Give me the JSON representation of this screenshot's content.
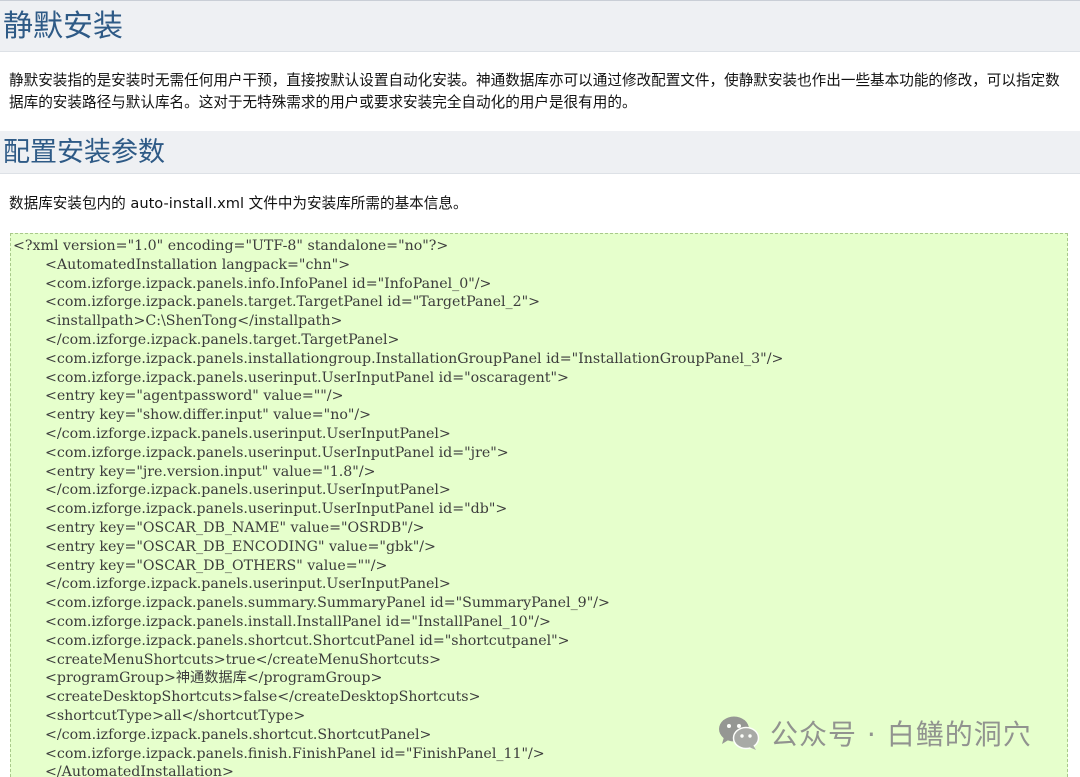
{
  "sections": {
    "silent_install": {
      "title": "静默安装",
      "paragraph": "静默安装指的是安装时无需任何用户干预，直接按默认设置自动化安装。神通数据库亦可以通过修改配置文件，使静默安装也作出一些基本功能的修改，可以指定数据库的安装路径与默认库名。这对于无特殊需求的用户或要求安装完全自动化的用户是很有用的。"
    },
    "config_params": {
      "title": "配置安装参数",
      "paragraph": "数据库安装包内的 auto-install.xml 文件中为安装库所需的基本信息。"
    }
  },
  "code_block": {
    "lines": [
      {
        "indent": 0,
        "text": "<?xml version=\"1.0\" encoding=\"UTF-8\" standalone=\"no\"?>"
      },
      {
        "indent": 1,
        "text": "<AutomatedInstallation langpack=\"chn\">"
      },
      {
        "indent": 1,
        "text": "<com.izforge.izpack.panels.info.InfoPanel id=\"InfoPanel_0\"/>"
      },
      {
        "indent": 1,
        "text": "<com.izforge.izpack.panels.target.TargetPanel id=\"TargetPanel_2\">"
      },
      {
        "indent": 1,
        "text": "<installpath>C:\\ShenTong</installpath>"
      },
      {
        "indent": 1,
        "text": "</com.izforge.izpack.panels.target.TargetPanel>"
      },
      {
        "indent": 1,
        "text": "<com.izforge.izpack.panels.installationgroup.InstallationGroupPanel id=\"InstallationGroupPanel_3\"/>"
      },
      {
        "indent": 1,
        "text": "<com.izforge.izpack.panels.userinput.UserInputPanel id=\"oscaragent\">"
      },
      {
        "indent": 1,
        "text": "<entry key=\"agentpassword\" value=\"\"/>"
      },
      {
        "indent": 1,
        "text": "<entry key=\"show.differ.input\" value=\"no\"/>"
      },
      {
        "indent": 1,
        "text": "</com.izforge.izpack.panels.userinput.UserInputPanel>"
      },
      {
        "indent": 1,
        "text": "<com.izforge.izpack.panels.userinput.UserInputPanel id=\"jre\">"
      },
      {
        "indent": 1,
        "text": "<entry key=\"jre.version.input\" value=\"1.8\"/>"
      },
      {
        "indent": 1,
        "text": "</com.izforge.izpack.panels.userinput.UserInputPanel>"
      },
      {
        "indent": 1,
        "text": "<com.izforge.izpack.panels.userinput.UserInputPanel id=\"db\">"
      },
      {
        "indent": 1,
        "text": "<entry key=\"OSCAR_DB_NAME\" value=\"OSRDB\"/>"
      },
      {
        "indent": 1,
        "text": "<entry key=\"OSCAR_DB_ENCODING\" value=\"gbk\"/>"
      },
      {
        "indent": 1,
        "text": "<entry key=\"OSCAR_DB_OTHERS\" value=\"\"/>"
      },
      {
        "indent": 1,
        "text": "</com.izforge.izpack.panels.userinput.UserInputPanel>"
      },
      {
        "indent": 1,
        "text": "<com.izforge.izpack.panels.summary.SummaryPanel id=\"SummaryPanel_9\"/>"
      },
      {
        "indent": 1,
        "text": "<com.izforge.izpack.panels.install.InstallPanel id=\"InstallPanel_10\"/>"
      },
      {
        "indent": 1,
        "text": "<com.izforge.izpack.panels.shortcut.ShortcutPanel id=\"shortcutpanel\">"
      },
      {
        "indent": 1,
        "text": "<createMenuShortcuts>true</createMenuShortcuts>"
      },
      {
        "indent": 1,
        "text": "<programGroup>神通数据库</programGroup>"
      },
      {
        "indent": 1,
        "text": "<createDesktopShortcuts>false</createDesktopShortcuts>"
      },
      {
        "indent": 1,
        "text": "<shortcutType>all</shortcutType>"
      },
      {
        "indent": 1,
        "text": "</com.izforge.izpack.panels.shortcut.ShortcutPanel>"
      },
      {
        "indent": 1,
        "text": "<com.izforge.izpack.panels.finish.FinishPanel id=\"FinishPanel_11\"/>"
      },
      {
        "indent": 1,
        "text": "</AutomatedInstallation>"
      }
    ]
  },
  "watermark": {
    "icon": "wechat-icon",
    "text": "公众号 · 白鳝的洞穴"
  },
  "colors": {
    "heading_text": "#2e5a86",
    "heading_band": "#eef0f3",
    "code_background": "#e6ffcc",
    "code_border": "#a8c98a"
  }
}
